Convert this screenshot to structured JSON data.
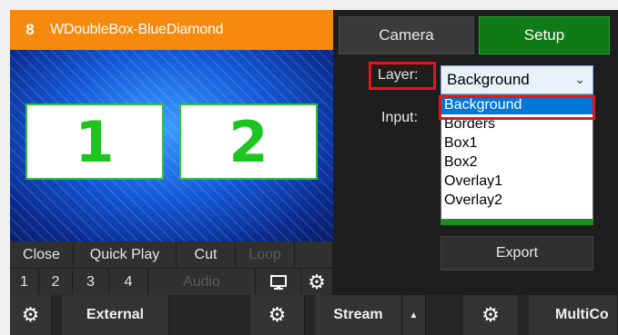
{
  "input": {
    "number": "8",
    "title": "WDoubleBox-BlueDiamond",
    "boxes": [
      "1",
      "2"
    ]
  },
  "controls": {
    "close": "Close",
    "quick_play": "Quick Play",
    "cut": "Cut",
    "loop": "Loop",
    "numbers": [
      "1",
      "2",
      "3",
      "4"
    ],
    "audio": "Audio",
    "monitor_icon": "monitor-icon",
    "gear_icon": "gear-icon"
  },
  "tabs": {
    "camera": "Camera",
    "setup": "Setup"
  },
  "fields": {
    "layer_label": "Layer:",
    "layer_value": "Background",
    "input_label": "Input:"
  },
  "layer_options": [
    "Background",
    "Borders",
    "Box1",
    "Box2",
    "Overlay1",
    "Overlay2"
  ],
  "export": "Export",
  "bottom_bar": {
    "external": "External",
    "stream": "Stream",
    "stream_arrow": "▲",
    "multicorder": "MultiCo"
  },
  "colors": {
    "header": "#f58a0e",
    "setup": "#0f7a16",
    "highlight": "#e3161c",
    "selected_option": "#0078d7"
  }
}
